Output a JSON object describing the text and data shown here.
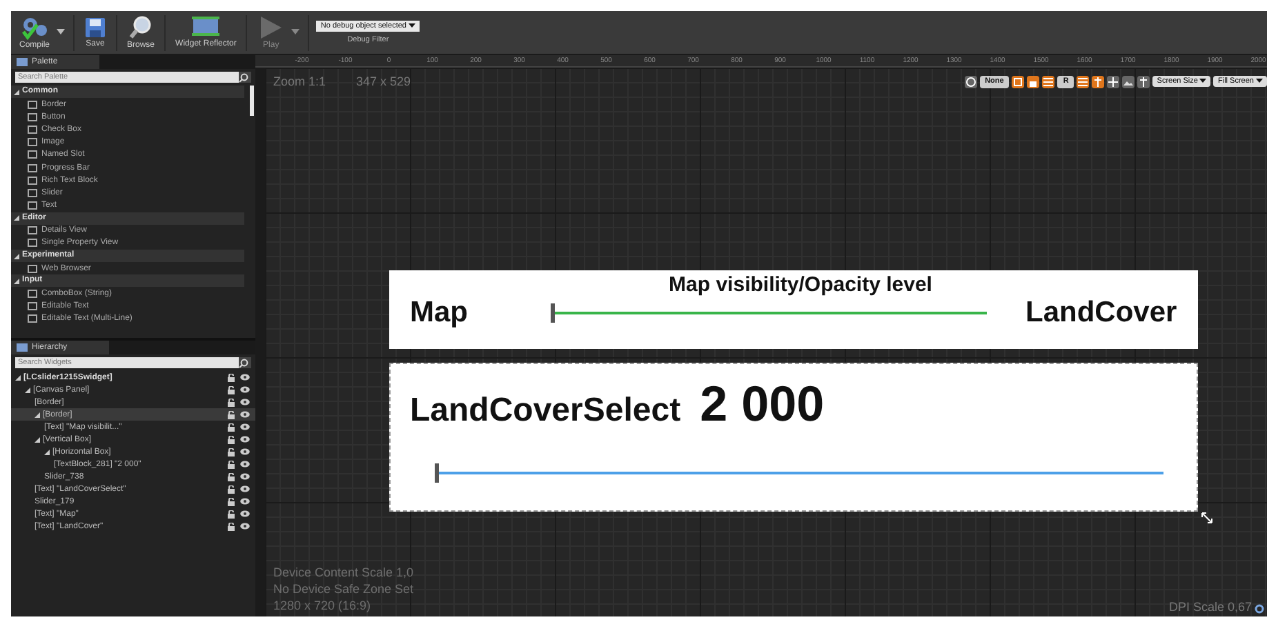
{
  "toolbar": {
    "buttons": [
      {
        "label": "Compile",
        "kind": "compile",
        "disabled": false,
        "menu": true
      },
      {
        "label": "Save",
        "kind": "save",
        "disabled": false,
        "menu": false
      },
      {
        "label": "Browse",
        "kind": "browse",
        "disabled": false,
        "menu": false
      },
      {
        "label": "Widget Reflector",
        "kind": "reflector",
        "disabled": false,
        "menu": false
      },
      {
        "label": "Play",
        "kind": "play",
        "disabled": true,
        "menu": true
      }
    ],
    "debug": {
      "value": "No debug object selected",
      "caption": "Debug Filter"
    }
  },
  "palette": {
    "tab": "Palette",
    "search": {
      "placeholder": "Search Palette"
    },
    "categories": [
      {
        "name": "Common",
        "items": [
          "Border",
          "Button",
          "Check Box",
          "Image",
          "Named Slot",
          "Progress Bar",
          "Rich Text Block",
          "Slider",
          "Text"
        ]
      },
      {
        "name": "Editor",
        "items": [
          "Details View",
          "Single Property View"
        ]
      },
      {
        "name": "Experimental",
        "items": [
          "Web Browser"
        ]
      },
      {
        "name": "Input",
        "items": [
          "ComboBox (String)",
          "Editable Text",
          "Editable Text (Multi-Line)"
        ]
      }
    ]
  },
  "hierarchy": {
    "tab": "Hierarchy",
    "search": {
      "placeholder": "Search Widgets"
    },
    "tree": [
      {
        "label": "[LCslider1215Swidget]",
        "selected": false,
        "children": [
          {
            "label": "[Canvas Panel]",
            "selected": false,
            "children": [
              {
                "label": "[Border]",
                "selected": false
              },
              {
                "label": "[Border]",
                "selected": true,
                "children": [
                  {
                    "label": "[Text] \"Map visibilit...\"",
                    "selected": false
                  }
                ]
              },
              {
                "label": "[Vertical Box]",
                "selected": false,
                "children": [
                  {
                    "label": "[Horizontal Box]",
                    "selected": false,
                    "children": [
                      {
                        "label": "[TextBlock_281] \"2 000\"",
                        "selected": false
                      }
                    ]
                  },
                  {
                    "label": "Slider_738",
                    "selected": false
                  }
                ]
              },
              {
                "label": "[Text] \"LandCoverSelect\"",
                "selected": false
              },
              {
                "label": "Slider_179",
                "selected": false
              },
              {
                "label": "[Text] \"Map\"",
                "selected": false
              },
              {
                "label": "[Text] \"LandCover\"",
                "selected": false
              }
            ]
          }
        ]
      }
    ]
  },
  "canvas": {
    "ruler": [
      "-200",
      "-100",
      "0",
      "100",
      "200",
      "300",
      "400",
      "500",
      "600",
      "700",
      "800",
      "900",
      "1000",
      "1100",
      "1200",
      "1300",
      "1400",
      "1500",
      "1600",
      "1700",
      "1800",
      "1900",
      "2000"
    ],
    "zoom": "Zoom 1:1",
    "size": "347 x 529",
    "tools": [
      {
        "kind": "globe",
        "on": false
      },
      {
        "kind": "text",
        "label": "None",
        "on": false
      },
      {
        "kind": "square",
        "on": true
      },
      {
        "kind": "lock",
        "on": true
      },
      {
        "kind": "grid",
        "on": true
      },
      {
        "kind": "text",
        "label": "R",
        "on": false
      },
      {
        "kind": "grid",
        "on": true
      },
      {
        "kind": "pin",
        "on": true
      },
      {
        "kind": "move",
        "on": false
      },
      {
        "kind": "image",
        "on": false
      },
      {
        "kind": "pin",
        "on": false
      }
    ],
    "dropdowns": [
      "Screen Size",
      "Fill Screen"
    ],
    "opacity_panel": {
      "title": "Map visibility/Opacity level",
      "left": "Map",
      "right": "LandCover",
      "slider": {
        "level": 0
      }
    },
    "select_panel": {
      "label": "LandCoverSelect",
      "value": "2 000",
      "slider": {
        "level": 0
      }
    },
    "info": [
      "Device Content Scale 1,0",
      "No Device Safe Zone Set",
      "1280 x 720 (16:9)"
    ],
    "dpi": "DPI Scale 0,67"
  }
}
